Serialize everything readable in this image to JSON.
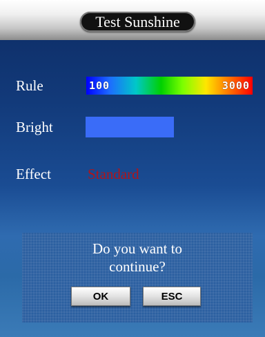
{
  "header": {
    "title": "Test Sunshine"
  },
  "rows": {
    "rule": {
      "label": "Rule",
      "min": "100",
      "max": "3000"
    },
    "bright": {
      "label": "Bright",
      "swatch_color": "#3a6cf8"
    },
    "effect": {
      "label": "Effect",
      "value": "Standard",
      "value_color": "#b0141a"
    }
  },
  "dialog": {
    "message_line1": "Do you want to",
    "message_line2": "continue?",
    "ok_label": "OK",
    "esc_label": "ESC"
  }
}
